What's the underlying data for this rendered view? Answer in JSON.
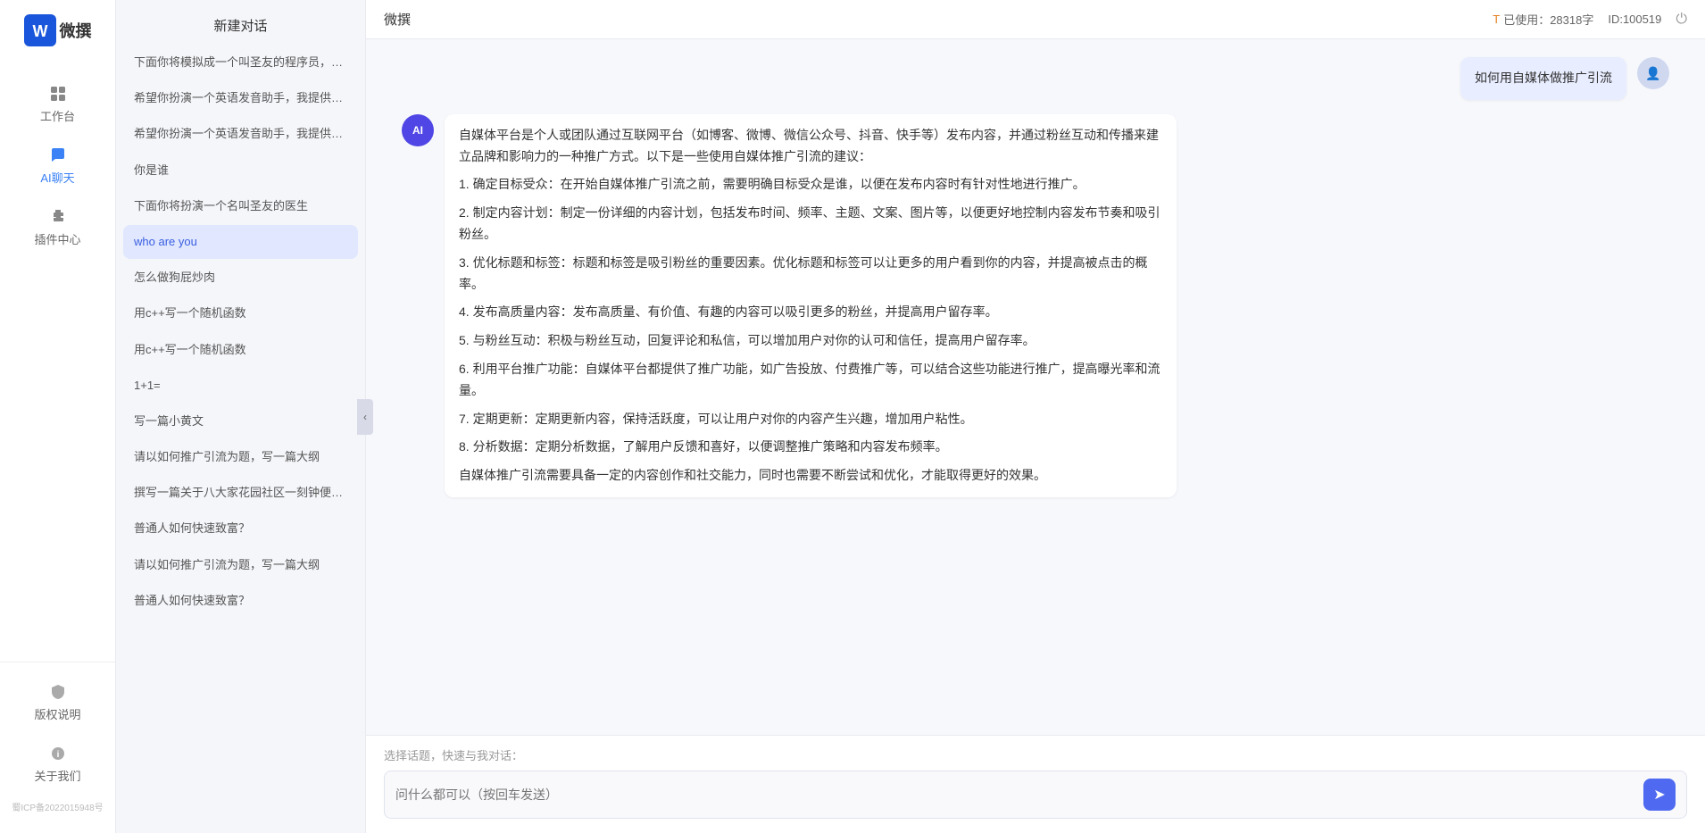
{
  "app": {
    "title": "微撰",
    "logo_text": "微撰"
  },
  "header": {
    "usage_label": "已使用：28318字",
    "id_label": "ID:100519",
    "usage_icon": "T"
  },
  "sidebar": {
    "nav_items": [
      {
        "id": "workbench",
        "label": "工作台",
        "icon": "grid"
      },
      {
        "id": "ai-chat",
        "label": "AI聊天",
        "icon": "chat",
        "active": true
      },
      {
        "id": "plugins",
        "label": "插件中心",
        "icon": "puzzle"
      }
    ],
    "bottom_items": [
      {
        "id": "copyright",
        "label": "版权说明",
        "icon": "shield"
      },
      {
        "id": "about",
        "label": "关于我们",
        "icon": "info"
      }
    ],
    "icp": "蜀ICP备2022015948号"
  },
  "chat_list": {
    "new_chat": "新建对话",
    "items": [
      {
        "id": 1,
        "text": "下面你将模拟成一个叫圣友的程序员，我说...",
        "active": false
      },
      {
        "id": 2,
        "text": "希望你扮演一个英语发音助手，我提供给你...",
        "active": false
      },
      {
        "id": 3,
        "text": "希望你扮演一个英语发音助手，我提供给你...",
        "active": false
      },
      {
        "id": 4,
        "text": "你是谁",
        "active": false
      },
      {
        "id": 5,
        "text": "下面你将扮演一个名叫圣友的医生",
        "active": false
      },
      {
        "id": 6,
        "text": "who are you",
        "active": true
      },
      {
        "id": 7,
        "text": "怎么做狗屁炒肉",
        "active": false
      },
      {
        "id": 8,
        "text": "用c++写一个随机函数",
        "active": false
      },
      {
        "id": 9,
        "text": "用c++写一个随机函数",
        "active": false
      },
      {
        "id": 10,
        "text": "1+1=",
        "active": false
      },
      {
        "id": 11,
        "text": "写一篇小黄文",
        "active": false
      },
      {
        "id": 12,
        "text": "请以如何推广引流为题，写一篇大纲",
        "active": false
      },
      {
        "id": 13,
        "text": "撰写一篇关于八大家花园社区一刻钟便民生...",
        "active": false
      },
      {
        "id": 14,
        "text": "普通人如何快速致富？",
        "active": false
      },
      {
        "id": 15,
        "text": "请以如何推广引流为题，写一篇大纲",
        "active": false
      },
      {
        "id": 16,
        "text": "普通人如何快速致富？",
        "active": false
      }
    ]
  },
  "chat": {
    "title": "微撰",
    "user_message": "如何用自媒体做推广引流",
    "ai_response_paragraphs": [
      "自媒体平台是个人或团队通过互联网平台（如博客、微博、微信公众号、抖音、快手等）发布内容，并通过粉丝互动和传播来建立品牌和影响力的一种推广方式。以下是一些使用自媒体推广引流的建议：",
      "1. 确定目标受众：在开始自媒体推广引流之前，需要明确目标受众是谁，以便在发布内容时有针对性地进行推广。",
      "2. 制定内容计划：制定一份详细的内容计划，包括发布时间、频率、主题、文案、图片等，以便更好地控制内容发布节奏和吸引粉丝。",
      "3. 优化标题和标签：标题和标签是吸引粉丝的重要因素。优化标题和标签可以让更多的用户看到你的内容，并提高被点击的概率。",
      "4. 发布高质量内容：发布高质量、有价值、有趣的内容可以吸引更多的粉丝，并提高用户留存率。",
      "5. 与粉丝互动：积极与粉丝互动，回复评论和私信，可以增加用户对你的认可和信任，提高用户留存率。",
      "6. 利用平台推广功能：自媒体平台都提供了推广功能，如广告投放、付费推广等，可以结合这些功能进行推广，提高曝光率和流量。",
      "7. 定期更新：定期更新内容，保持活跃度，可以让用户对你的内容产生兴趣，增加用户粘性。",
      "8. 分析数据：定期分析数据，了解用户反馈和喜好，以便调整推广策略和内容发布频率。",
      "自媒体推广引流需要具备一定的内容创作和社交能力，同时也需要不断尝试和优化，才能取得更好的效果。"
    ],
    "input_placeholder": "问什么都可以（按回车发送）",
    "quick_topic_label": "选择话题，快速与我对话："
  }
}
